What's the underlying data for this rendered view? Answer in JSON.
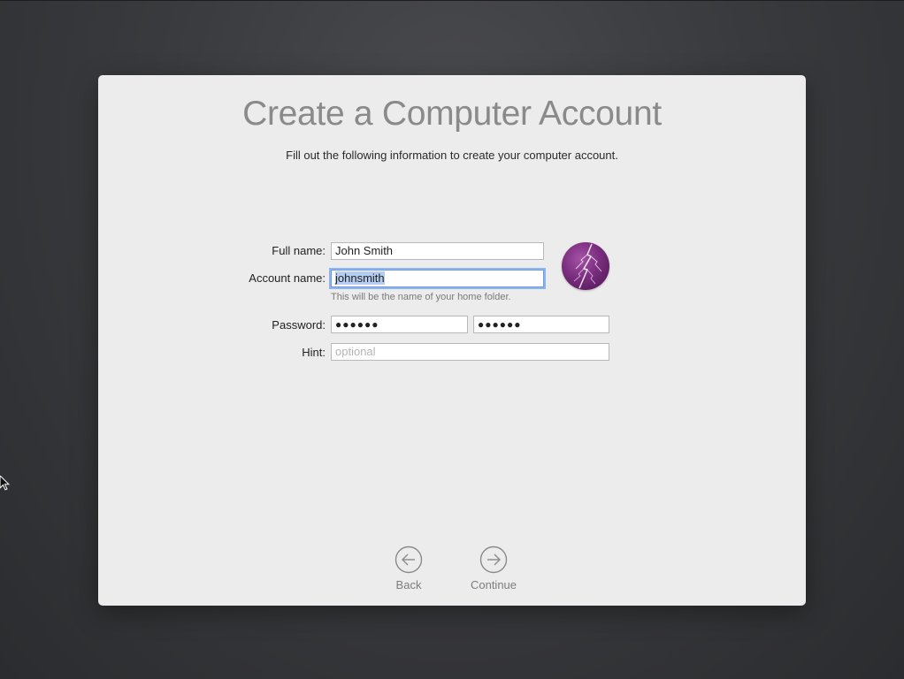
{
  "dialog": {
    "title": "Create a Computer Account",
    "subtitle": "Fill out the following information to create your computer account."
  },
  "form": {
    "full_name": {
      "label": "Full name:",
      "value": "John Smith"
    },
    "account_name": {
      "label": "Account name:",
      "value": "johnsmith",
      "helper": "This will be the name of your home folder."
    },
    "password": {
      "label": "Password:",
      "value": "●●●●●●",
      "verify_value": "●●●●●●"
    },
    "hint": {
      "label": "Hint:",
      "placeholder": "optional",
      "value": ""
    }
  },
  "avatar": {
    "icon": "lightning-icon",
    "color": "#7b2e7f"
  },
  "navigation": {
    "back": {
      "label": "Back",
      "icon": "arrow-left-circle-icon"
    },
    "continue": {
      "label": "Continue",
      "icon": "arrow-right-circle-icon"
    }
  },
  "colors": {
    "background": "#3a3b3e",
    "panel": "#ececec",
    "title": "#8a8a8a",
    "focus_ring": "#8cb4ee",
    "selection": "#b4cdf0"
  }
}
